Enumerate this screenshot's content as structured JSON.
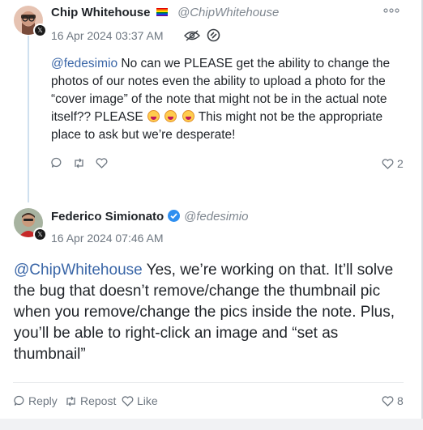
{
  "post": {
    "author_name": "Chip Whitehouse",
    "author_emoji": "🏳️‍🌈",
    "handle": "@ChipWhitehouse",
    "timestamp": "16 Apr 2024 03:37 AM",
    "mention": "@fedesimio",
    "text_before_emoji": " No can we PLEASE get the ability to change the photos of our notes even the ability to upload a photo for the “cover image” of the note that might not be in the actual note itself?? PLEASE ",
    "text_after_emoji": " This might not be the appropriate place to ask but we’re desperate!",
    "like_count": "2"
  },
  "reply": {
    "author_name": "Federico Simionato",
    "handle": "@fedesimio",
    "timestamp": "16 Apr 2024 07:46 AM",
    "mention": "@ChipWhitehouse",
    "text": " Yes, we’re working on that. It’ll solve the bug that doesn’t remove/change the thumbnail pic when you remove/change the pics inside the note. Plus, you’ll be able to right-click an image and “set as thumbnail”",
    "reply_label": "Reply",
    "repost_label": "Repost",
    "like_label": "Like",
    "like_count": "8"
  },
  "icons": {
    "more": "more-icon",
    "visibility": "eye-icon",
    "source": "app-icon",
    "verified": "verified-badge-icon",
    "comment": "comment-icon",
    "repost": "repost-icon",
    "heart": "heart-icon"
  },
  "colors": {
    "mention": "#3a66a7",
    "thread_line": "#cfe0ef",
    "verified": "#2f8ff0",
    "muted": "#6e7781"
  }
}
